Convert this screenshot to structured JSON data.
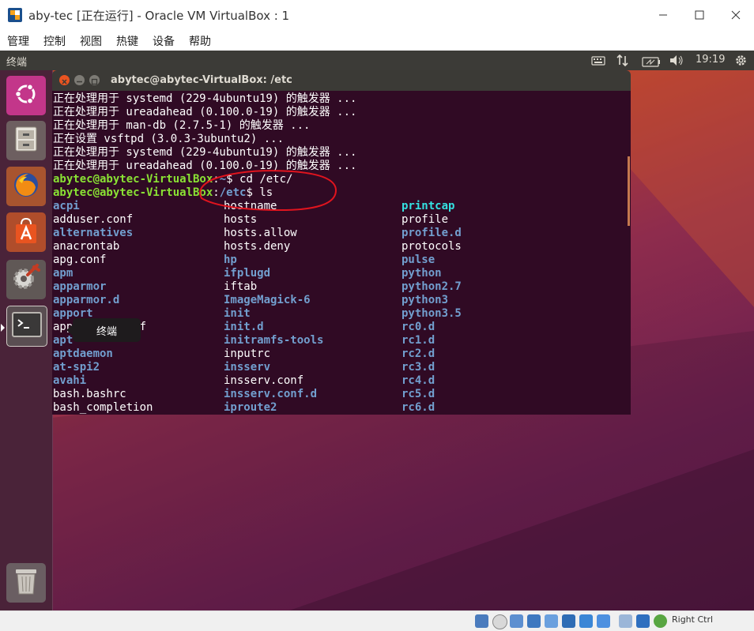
{
  "window": {
    "title": "aby-tec [正在运行] - Oracle VM VirtualBox : 1",
    "menu": [
      "管理",
      "控制",
      "视图",
      "热键",
      "设备",
      "帮助"
    ]
  },
  "ubuntu_panel": {
    "app_title": "终端",
    "time": "19:19",
    "indicators": [
      "keyboard-icon",
      "network-icon",
      "battery-icon",
      "volume-icon",
      "settings-gear-icon"
    ]
  },
  "launcher": {
    "items": [
      {
        "name": "ubuntu-dash",
        "icon": "ubuntu-logo-icon"
      },
      {
        "name": "files",
        "icon": "file-cabinet-icon"
      },
      {
        "name": "firefox",
        "icon": "firefox-icon"
      },
      {
        "name": "software-center",
        "icon": "shopping-bag-icon"
      },
      {
        "name": "system-settings",
        "icon": "gear-wrench-icon"
      },
      {
        "name": "terminal",
        "icon": "terminal-icon"
      },
      {
        "name": "trash",
        "icon": "trash-icon"
      }
    ],
    "tooltip": "终端"
  },
  "terminal": {
    "title": "abytec@abytec-VirtualBox: /etc",
    "log_lines": [
      "正在处理用于 systemd (229-4ubuntu19) 的触发器 ...",
      "正在处理用于 ureadahead (0.100.0-19) 的触发器 ...",
      "正在处理用于 man-db (2.7.5-1) 的触发器 ...",
      "正在设置 vsftpd (3.0.3-3ubuntu2) ...",
      "正在处理用于 systemd (229-4ubuntu19) 的触发器 ...",
      "正在处理用于 ureadahead (0.100.0-19) 的触发器 ..."
    ],
    "prompt1": {
      "user": "abytec@abytec-VirtualBox",
      "path": "~",
      "cmd": "$ cd /etc/"
    },
    "prompt2": {
      "user": "abytec@abytec-VirtualBox",
      "path": "/etc",
      "cmd": "$ ls"
    },
    "ls_columns": [
      [
        {
          "t": "acpi",
          "k": "b"
        },
        {
          "t": "adduser.conf",
          "k": "w"
        },
        {
          "t": "alternatives",
          "k": "b"
        },
        {
          "t": "anacrontab",
          "k": "w"
        },
        {
          "t": "apg.conf",
          "k": "w"
        },
        {
          "t": "apm",
          "k": "b"
        },
        {
          "t": "apparmor",
          "k": "b"
        },
        {
          "t": "apparmor.d",
          "k": "b"
        },
        {
          "t": "apport",
          "k": "b"
        },
        {
          "t": "appstream.conf",
          "k": "w"
        },
        {
          "t": "apt",
          "k": "b"
        },
        {
          "t": "aptdaemon",
          "k": "b"
        },
        {
          "t": "at-spi2",
          "k": "b"
        },
        {
          "t": "avahi",
          "k": "b"
        },
        {
          "t": "bash.bashrc",
          "k": "w"
        },
        {
          "t": "bash_completion",
          "k": "w"
        }
      ],
      [
        {
          "t": "hostname",
          "k": "w"
        },
        {
          "t": "hosts",
          "k": "w"
        },
        {
          "t": "hosts.allow",
          "k": "w"
        },
        {
          "t": "hosts.deny",
          "k": "w"
        },
        {
          "t": "hp",
          "k": "b"
        },
        {
          "t": "ifplugd",
          "k": "b"
        },
        {
          "t": "iftab",
          "k": "w"
        },
        {
          "t": "ImageMagick-6",
          "k": "b"
        },
        {
          "t": "init",
          "k": "b"
        },
        {
          "t": "init.d",
          "k": "b"
        },
        {
          "t": "initramfs-tools",
          "k": "b"
        },
        {
          "t": "inputrc",
          "k": "w"
        },
        {
          "t": "insserv",
          "k": "b"
        },
        {
          "t": "insserv.conf",
          "k": "w"
        },
        {
          "t": "insserv.conf.d",
          "k": "b"
        },
        {
          "t": "iproute2",
          "k": "b"
        }
      ],
      [
        {
          "t": "printcap",
          "k": "c"
        },
        {
          "t": "profile",
          "k": "w"
        },
        {
          "t": "profile.d",
          "k": "b"
        },
        {
          "t": "protocols",
          "k": "w"
        },
        {
          "t": "pulse",
          "k": "b"
        },
        {
          "t": "python",
          "k": "b"
        },
        {
          "t": "python2.7",
          "k": "b"
        },
        {
          "t": "python3",
          "k": "b"
        },
        {
          "t": "python3.5",
          "k": "b"
        },
        {
          "t": "rc0.d",
          "k": "b"
        },
        {
          "t": "rc1.d",
          "k": "b"
        },
        {
          "t": "rc2.d",
          "k": "b"
        },
        {
          "t": "rc3.d",
          "k": "b"
        },
        {
          "t": "rc4.d",
          "k": "b"
        },
        {
          "t": "rc5.d",
          "k": "b"
        },
        {
          "t": "rc6.d",
          "k": "b"
        }
      ]
    ]
  },
  "status_bar": {
    "host_key": "Right Ctrl",
    "colors": {
      "annotation": "#e0141e"
    }
  }
}
